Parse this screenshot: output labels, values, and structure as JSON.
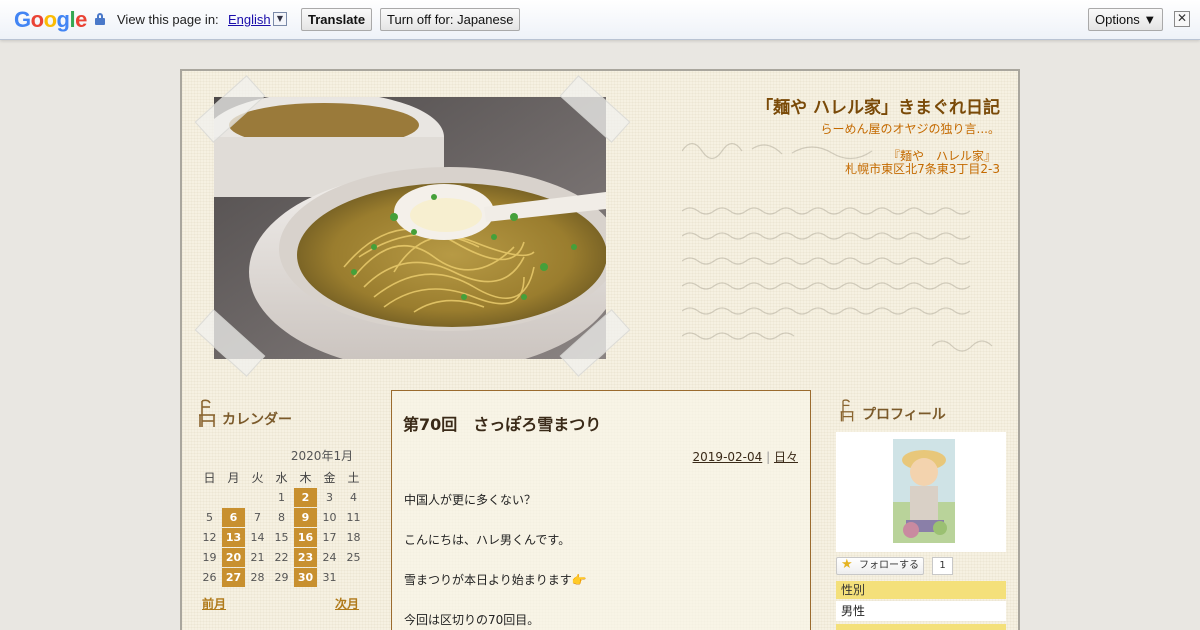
{
  "translate_bar": {
    "logo": "Google",
    "view_text": "View this page in:",
    "language": "English",
    "translate_label": "Translate",
    "turn_off_label": "Turn off for: Japanese",
    "options_label": "Options ▼",
    "close_glyph": "✕"
  },
  "blog": {
    "title": "「麺や ハレル家」きまぐれ日記",
    "subtitle": "らーめん屋のオヤジの独り言...。",
    "shop_name": "『麺や　ハレル家』",
    "shop_address": "札幌市東区北7条東3丁目2-3"
  },
  "calendar": {
    "heading": "カレンダー",
    "month": "2020年1月",
    "weekdays": [
      "日",
      "月",
      "火",
      "水",
      "木",
      "金",
      "土"
    ],
    "weeks": [
      [
        "",
        "",
        "",
        "1",
        "2",
        "3",
        "4"
      ],
      [
        "5",
        "6",
        "7",
        "8",
        "9",
        "10",
        "11"
      ],
      [
        "12",
        "13",
        "14",
        "15",
        "16",
        "17",
        "18"
      ],
      [
        "19",
        "20",
        "21",
        "22",
        "23",
        "24",
        "25"
      ],
      [
        "26",
        "27",
        "28",
        "29",
        "30",
        "31",
        ""
      ]
    ],
    "highlighted": [
      "2",
      "6",
      "9",
      "13",
      "16",
      "20",
      "23",
      "27",
      "30"
    ],
    "prev_label": "前月",
    "next_label": "次月"
  },
  "post": {
    "title": "第70回　さっぽろ雪まつり",
    "date": "2019-02-04",
    "separator": "|",
    "category": "日々",
    "lines": [
      "中国人が更に多くない？",
      "こんにちは、ハレ男くんです。",
      "雪まつりが本日より始まります👉",
      "今回は区切りの70回目。"
    ]
  },
  "profile": {
    "heading": "プロフィール",
    "follow_label": "フォローする",
    "follow_count": "1",
    "gender_label": "性別",
    "gender_value": "男性"
  },
  "colors": {
    "accent": "#c8902f",
    "title_brown": "#7a4a08",
    "orange_text": "#c46a00",
    "paper": "#f6f1e2"
  }
}
